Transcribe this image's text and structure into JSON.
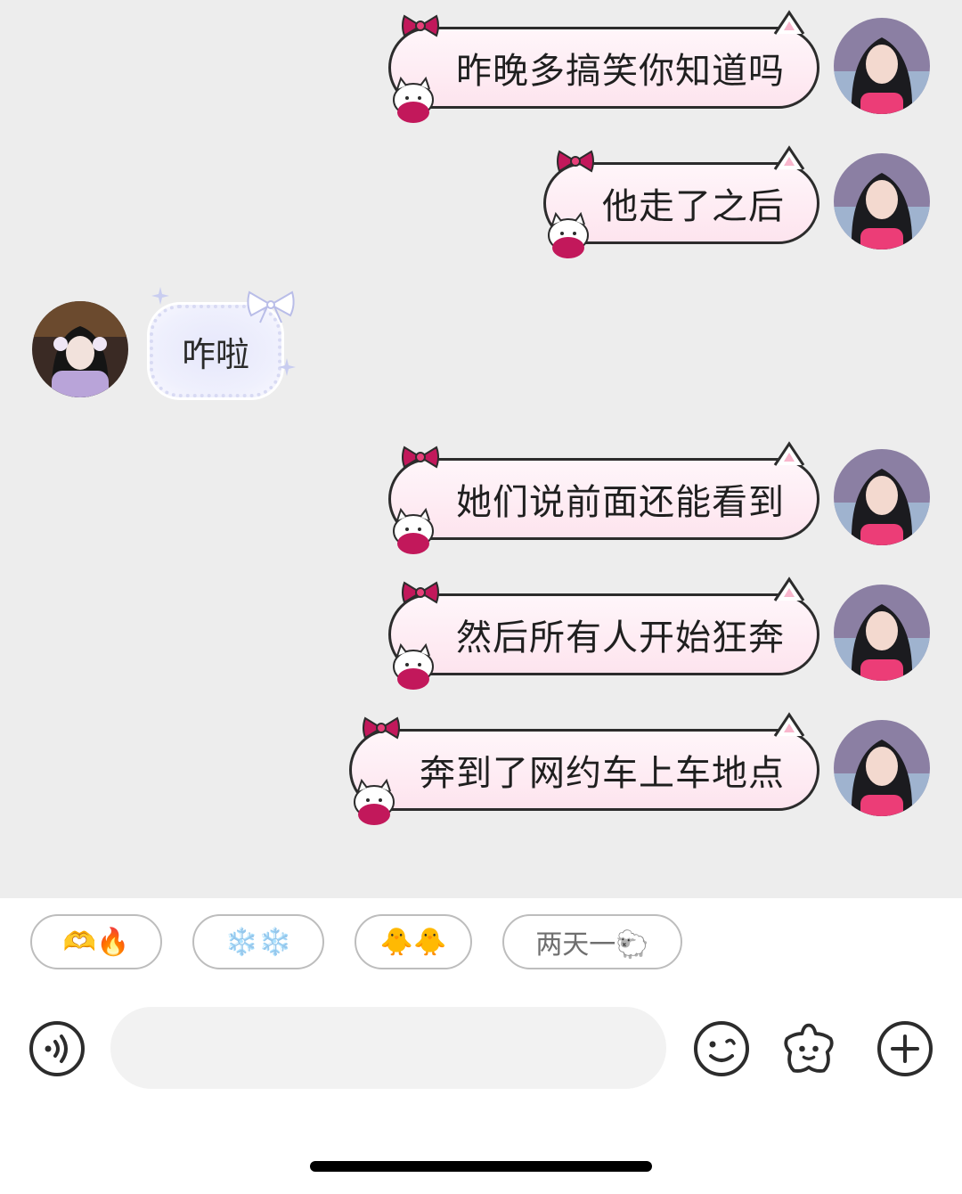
{
  "messages": [
    {
      "side": "out",
      "text": "昨晚多搞笑你知道吗"
    },
    {
      "side": "out",
      "text": "他走了之后"
    },
    {
      "side": "in",
      "text": "咋啦"
    },
    {
      "side": "out",
      "text": "她们说前面还能看到"
    },
    {
      "side": "out",
      "text": "然后所有人开始狂奔"
    },
    {
      "side": "out",
      "text": "奔到了网约车上车地点"
    }
  ],
  "quick_replies": [
    {
      "label": "🫶🔥",
      "icons": [
        "hands-icon",
        "fire-icon"
      ]
    },
    {
      "label": "❄️❄️",
      "icons": [
        "snowflake-icon",
        "snowflake-icon"
      ]
    },
    {
      "label": "🐥🐥",
      "icons": [
        "chick-icon",
        "chick-icon"
      ]
    },
    {
      "label": "两天一🐑",
      "icons": [
        "sheep-icon"
      ]
    }
  ],
  "input": {
    "placeholder": "",
    "value": ""
  },
  "toolbar_icons": [
    "voice-icon",
    "emoji-icon",
    "sticker-icon",
    "add-icon"
  ],
  "colors": {
    "chat_bg": "#ededed",
    "outgoing_bubble": "#fde4ee",
    "incoming_bubble": "#e6e7fb",
    "bow": "#c2185b",
    "accent_pink": "#e8407a"
  }
}
